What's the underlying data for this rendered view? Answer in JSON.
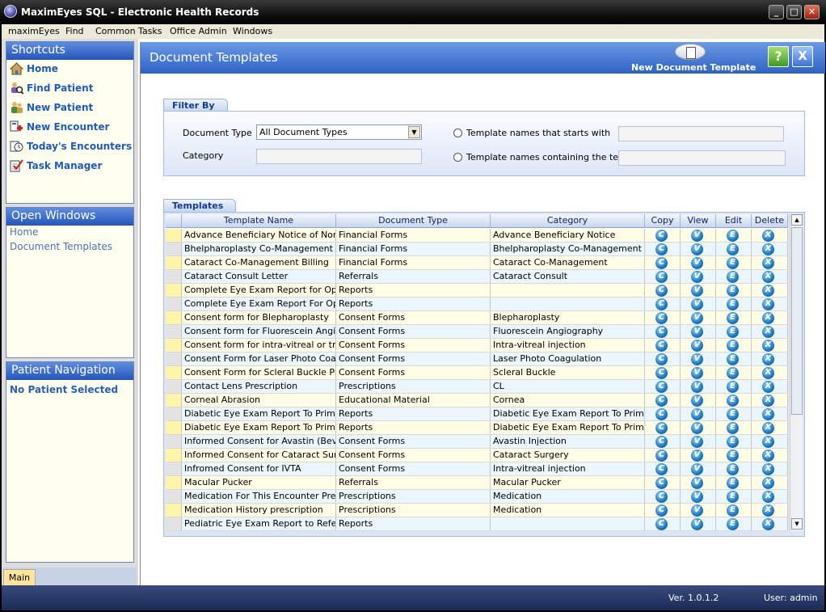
{
  "window": {
    "title": "MaximEyes SQL - Electronic Health Records"
  },
  "menu": [
    "maximEyes",
    "Find",
    "Common Tasks",
    "Office Admin",
    "Windows"
  ],
  "shortcuts": {
    "title": "Shortcuts",
    "items": [
      "Home",
      "Find Patient",
      "New Patient",
      "New Encounter",
      "Today's Encounters",
      "Task Manager"
    ]
  },
  "open_windows": {
    "title": "Open Windows",
    "items": [
      "Home",
      "Document Templates"
    ]
  },
  "patient_nav": {
    "title": "Patient Navigation",
    "status": "No Patient Selected"
  },
  "side_tab": "Main",
  "main": {
    "title": "Document Templates",
    "new_doc_label": "New Document Template",
    "help_label": "?",
    "close_label": "X"
  },
  "filter": {
    "tab": "Filter By",
    "doc_type_label": "Document Type",
    "doc_type_value": "All Document Types",
    "category_label": "Category",
    "starts_label": "Template names that starts with",
    "contains_label": "Template names containing the text"
  },
  "templates": {
    "tab": "Templates",
    "columns": [
      "Template Name",
      "Document Type",
      "Category",
      "Copy",
      "View",
      "Edit",
      "Delete"
    ],
    "rows": [
      [
        "Advance Beneficiary Notice of Non c",
        "Financial Forms",
        "Advance Beneficiary Notice"
      ],
      [
        "Bhelpharoplasty  Co-Management Bill",
        "Financial Forms",
        "Bhelpharoplasty Co-Management"
      ],
      [
        "Cataract Co-Management Billing",
        "Financial Forms",
        "Cataract Co-Management"
      ],
      [
        "Cataract Consult Letter",
        "Referrals",
        "Cataract Consult"
      ],
      [
        "Complete Eye Exam Report  for Opht",
        "Reports",
        ""
      ],
      [
        "Complete Eye Exam Report For Opt",
        "Reports",
        ""
      ],
      [
        "Consent form for Blepharoplasty",
        "Consent Forms",
        "Blepharoplasty"
      ],
      [
        "Consent form for Fluorescein Angiog",
        "Consent Forms",
        "Fluorescein Angiography"
      ],
      [
        "Consent form for intra-vitreal or tran",
        "Consent Forms",
        "Intra-vitreal injection"
      ],
      [
        "Consent Form for Laser Photo Coag",
        "Consent Forms",
        "Laser Photo Coagulation"
      ],
      [
        "Consent Form for  Scleral Buckle Pro",
        "Consent Forms",
        "Scleral Buckle"
      ],
      [
        "Contact Lens Prescription",
        "Prescriptions",
        "CL"
      ],
      [
        "Corneal Abrasion",
        "Educational Material",
        "Cornea"
      ],
      [
        "Diabetic Eye Exam Report  To Primar",
        "Reports",
        "Diabetic Eye Exam Report  To Primar"
      ],
      [
        "Diabetic Eye Exam Report  To Primar",
        "Reports",
        "Diabetic Eye Exam Report  To Primar"
      ],
      [
        "Informed Consent  for Avastin (Beva",
        "Consent Forms",
        "Avastin Injection"
      ],
      [
        "Informed Consent  for Cataract Surg",
        "Consent Forms",
        "Cataract Surgery"
      ],
      [
        "Infromed Consent for IVTA",
        "Consent Forms",
        "Intra-vitreal injection"
      ],
      [
        "Macular Pucker",
        "Referrals",
        "Macular Pucker"
      ],
      [
        "Medication For  This Encounter Presc",
        "Prescriptions",
        "Medication"
      ],
      [
        "Medication History prescription",
        "Prescriptions",
        "Medication"
      ],
      [
        "Pediatric Eye Exam Report to Referri",
        "Reports",
        ""
      ]
    ],
    "action_glyphs": [
      "C",
      "V",
      "E",
      "X"
    ]
  },
  "status": {
    "version": "Ver. 1.0.1.2",
    "user": "User: admin"
  }
}
